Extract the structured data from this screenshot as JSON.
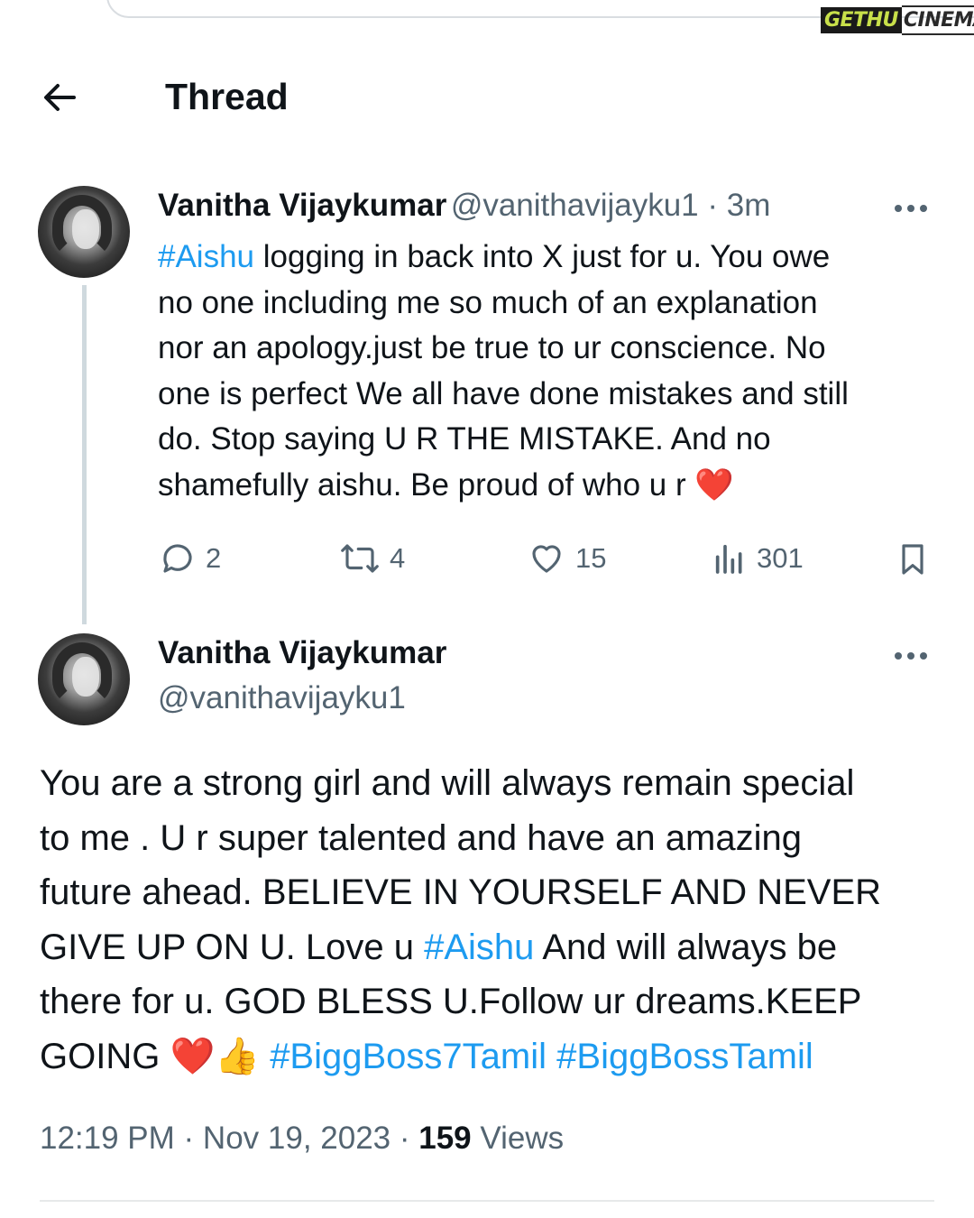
{
  "watermark": {
    "part1": "GETHU",
    "part2": "CINEMA"
  },
  "header": {
    "title": "Thread"
  },
  "reply_tweet": {
    "author_name": "Vanitha Vijaykumar",
    "handle": "@vanithavijayku1",
    "separator": " · ",
    "time": "3m",
    "lines": [
      {
        "hashtag": "#Aishu",
        "text": " logging in back into X just for u. You owe"
      },
      {
        "text": "no one including me so much of an explanation"
      },
      {
        "text": "nor an apology.just be true to ur conscience. No"
      },
      {
        "text": "one is perfect We all have done  mistakes and still"
      },
      {
        "text": "do. Stop saying U R THE MISTAKE. And no"
      },
      {
        "text": "shamefully aishu. Be proud of who u r "
      }
    ],
    "heart_emoji": "❤️",
    "actions": {
      "replies": "2",
      "reposts": "4",
      "likes": "15",
      "views": "301"
    }
  },
  "main_tweet": {
    "author_name": "Vanitha Vijaykumar",
    "handle": "@vanithavijayku1",
    "lines": [
      {
        "text": "You are a strong girl and will always remain special"
      },
      {
        "text": "to me . U r super talented and have an amazing"
      },
      {
        "text": "future ahead. BELIEVE IN YOURSELF AND NEVER"
      },
      {
        "text": "GIVE UP ON U. Love u ",
        "hashtag": "#Aishu",
        "after": " And will always be"
      },
      {
        "text": "there for u. GOD BLESS U.Follow ur dreams.KEEP"
      },
      {
        "text": "GOING "
      }
    ],
    "emojis": "❤️👍",
    "hashtag_1": "#BiggBoss7Tamil",
    "hashtag_2": "#BiggBossTamil",
    "time": "12:19 PM",
    "date": "Nov 19, 2023",
    "views_count": "159",
    "views_label": "Views"
  },
  "colors": {
    "accent": "#1d9bf0",
    "secondary_text": "#536471",
    "heart": "#e0245e"
  }
}
